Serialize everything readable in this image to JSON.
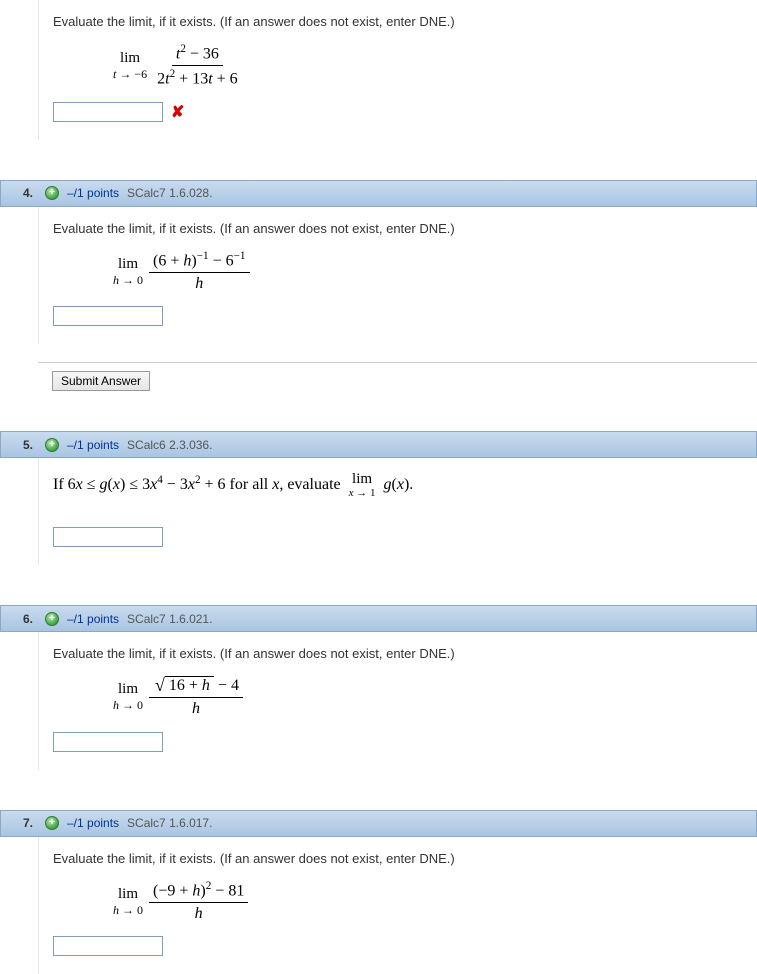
{
  "questions": {
    "top": {
      "prompt": "Evaluate the limit, if it exists. (If an answer does not exist, enter DNE.)",
      "lim_label": "lim",
      "lim_sub": "t → −6",
      "frac_num": "t² − 36",
      "frac_den": "2t² + 13t + 6",
      "wrong_mark": "✘"
    },
    "q4": {
      "number": "4.",
      "points": "–/1 points",
      "ref": "SCalc7 1.6.028.",
      "prompt": "Evaluate the limit, if it exists. (If an answer does not exist, enter DNE.)",
      "lim_label": "lim",
      "lim_sub": "h → 0",
      "frac_num": "(6 + h)⁻¹ − 6⁻¹",
      "frac_den": "h",
      "submit": "Submit Answer"
    },
    "q5": {
      "number": "5.",
      "points": "–/1 points",
      "ref": "SCalc6 2.3.036.",
      "prompt_pre": "If 6",
      "prompt_mid1": " ≤ ",
      "prompt_g": "g",
      "prompt_x": "x",
      "prompt_mid2": ") ≤ 3",
      "prompt_mid3": " − 3",
      "prompt_mid4": " + 6 for all ",
      "prompt_post": ", evaluate ",
      "lim_label": "lim",
      "lim_sub": "x → 1",
      "lim_expr": "g(x)."
    },
    "q6": {
      "number": "6.",
      "points": "–/1 points",
      "ref": "SCalc7 1.6.021.",
      "prompt": "Evaluate the limit, if it exists. (If an answer does not exist, enter DNE.)",
      "lim_label": "lim",
      "lim_sub": "h → 0",
      "sqrt_radicand": "16 + h",
      "after_sqrt": " − 4",
      "frac_den": "h"
    },
    "q7": {
      "number": "7.",
      "points": "–/1 points",
      "ref": "SCalc7 1.6.017.",
      "prompt": "Evaluate the limit, if it exists. (If an answer does not exist, enter DNE.)",
      "lim_label": "lim",
      "lim_sub": "h → 0",
      "frac_num": "(−9 + h)² − 81",
      "frac_den": "h"
    }
  }
}
